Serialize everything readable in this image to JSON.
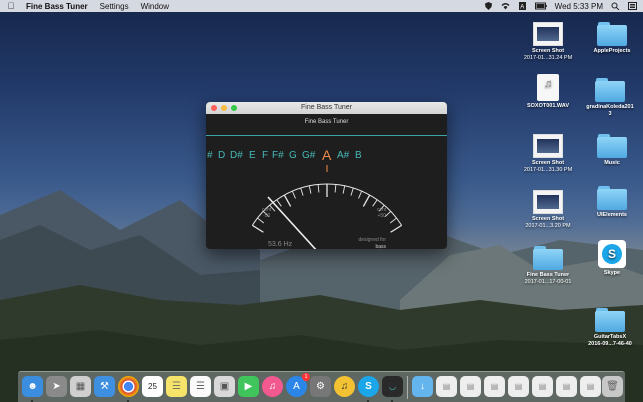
{
  "menubar": {
    "app_name": "Fine Bass Tuner",
    "menus": [
      "Settings",
      "Window"
    ],
    "clock": "Wed 5:33 PM"
  },
  "tuner_window": {
    "title": "Fine Bass Tuner",
    "subtitle": "Fine Bass Tuner",
    "notes": [
      "#",
      "D",
      "D#",
      "E",
      "F",
      "F#",
      "G",
      "G#",
      "A",
      "A#",
      "B"
    ],
    "active_note": "A",
    "cent_left_label": "cent",
    "cent_left_value": "-50",
    "cent_right_label": "cent",
    "cent_right_value": "+50",
    "frequency": "53.6 Hz",
    "designed_for_label": "designed for",
    "designed_for_value": "bass",
    "colors": {
      "note": "#47b9b9",
      "active_note": "#f08a4b",
      "teal_line": "#3aa6a6"
    }
  },
  "desktop_icons": [
    {
      "label": "Screen Shot",
      "sublabel": "2017-01...31.24 PM",
      "kind": "screenshot"
    },
    {
      "label": "AppleProjects",
      "sublabel": "",
      "kind": "folder"
    },
    {
      "label": "SOXOT001.WAV",
      "sublabel": "",
      "kind": "audio"
    },
    {
      "label": "gradinaKoleda201",
      "sublabel": "3",
      "kind": "folder"
    },
    {
      "label": "Screen Shot",
      "sublabel": "2017-01...31.30 PM",
      "kind": "screenshot"
    },
    {
      "label": "Music",
      "sublabel": "",
      "kind": "folder"
    },
    {
      "label": "Screen Shot",
      "sublabel": "2017-01...3.20 PM",
      "kind": "screenshot"
    },
    {
      "label": "UIElements",
      "sublabel": "",
      "kind": "folder"
    },
    {
      "label": "Fine Bass Tuner",
      "sublabel": "2017-01...17-00-01",
      "kind": "folder"
    },
    {
      "label": "Skype",
      "sublabel": "",
      "kind": "app"
    },
    {
      "label": "GuitarTabsX",
      "sublabel": "2016-09...7-46-40",
      "kind": "folder"
    }
  ],
  "dock": {
    "calendar_date": "25",
    "appstore_badge": "1",
    "items": [
      {
        "name": "finder",
        "icon": "finder-icon",
        "color": "#3b8de0"
      },
      {
        "name": "launchpad",
        "icon": "rocket-icon",
        "color": "#8a8a8a"
      },
      {
        "name": "notes-stack",
        "icon": "document-icon",
        "color": "#cfcfcf"
      },
      {
        "name": "xcode",
        "icon": "hammer-icon",
        "color": "#3f8fe0"
      },
      {
        "name": "chrome",
        "icon": "chrome-icon",
        "color": "#e4e4e4"
      },
      {
        "name": "calendar",
        "icon": "calendar-icon",
        "color": "#ffffff"
      },
      {
        "name": "notes",
        "icon": "notes-icon",
        "color": "#f5e36a"
      },
      {
        "name": "reminders",
        "icon": "list-icon",
        "color": "#fafafa"
      },
      {
        "name": "preview",
        "icon": "photos-icon",
        "color": "#d9d9d9"
      },
      {
        "name": "facetime",
        "icon": "video-icon",
        "color": "#3fc55c"
      },
      {
        "name": "itunes",
        "icon": "music-icon",
        "color": "#f25a8f"
      },
      {
        "name": "appstore",
        "icon": "appstore-icon",
        "color": "#2c86e8"
      },
      {
        "name": "system-preferences",
        "icon": "gear-icon",
        "color": "#777777"
      },
      {
        "name": "instruments",
        "icon": "speaker-icon",
        "color": "#f2c232"
      },
      {
        "name": "skype",
        "icon": "skype-icon",
        "color": "#1aa6e8"
      },
      {
        "name": "fine-bass-tuner",
        "icon": "tuner-icon",
        "color": "#2a2a2a"
      },
      {
        "name": "downloads",
        "icon": "folder-icon",
        "color": "#64b5ee"
      },
      {
        "name": "doc-1",
        "icon": "document-icon",
        "color": "#eeeeee"
      },
      {
        "name": "doc-2",
        "icon": "document-icon",
        "color": "#eeeeee"
      },
      {
        "name": "doc-3",
        "icon": "document-icon",
        "color": "#eeeeee"
      },
      {
        "name": "doc-4",
        "icon": "document-icon",
        "color": "#eeeeee"
      },
      {
        "name": "doc-5",
        "icon": "document-icon",
        "color": "#eeeeee"
      },
      {
        "name": "doc-6",
        "icon": "document-icon",
        "color": "#eeeeee"
      },
      {
        "name": "doc-7",
        "icon": "document-icon",
        "color": "#eeeeee"
      },
      {
        "name": "doc-8",
        "icon": "document-icon",
        "color": "#eeeeee"
      },
      {
        "name": "trash",
        "icon": "trash-icon",
        "color": "#c8c8c8"
      }
    ]
  }
}
